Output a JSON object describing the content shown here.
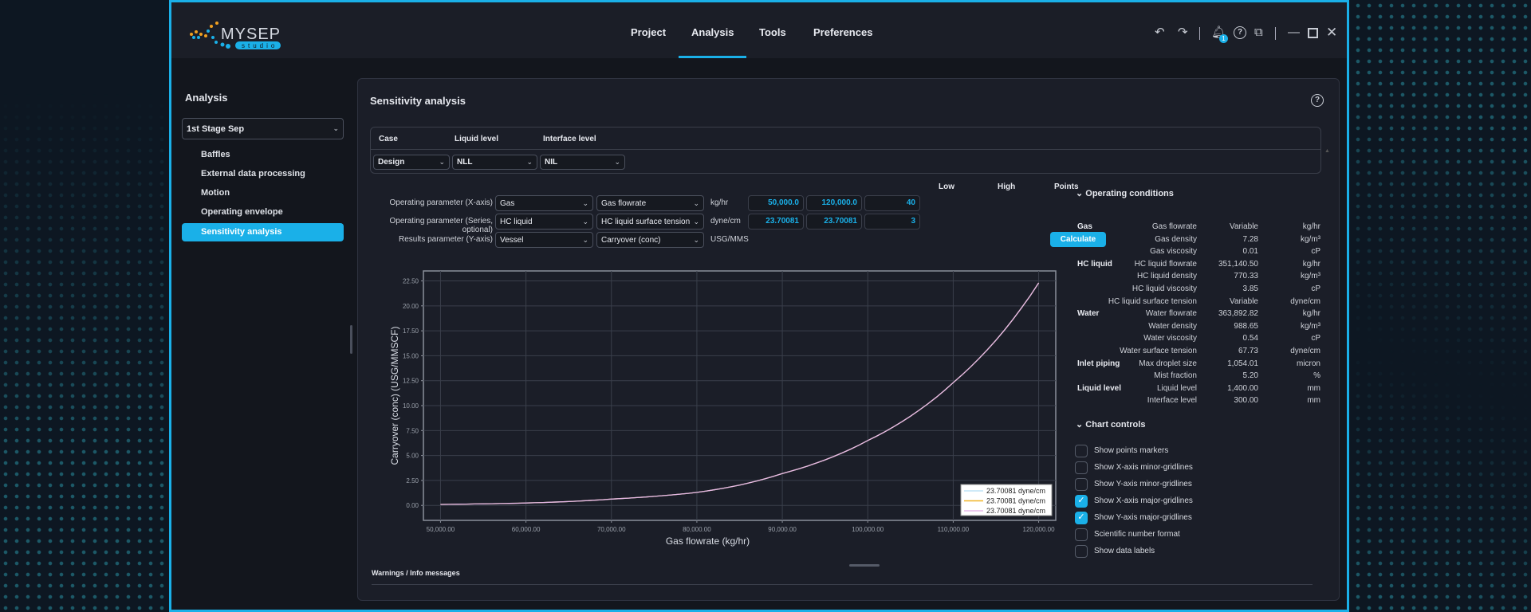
{
  "app": {
    "logo_text": "MYSEP",
    "logo_sub": "studio"
  },
  "nav": {
    "items": [
      "Project",
      "Analysis",
      "Tools",
      "Preferences"
    ],
    "active": "Analysis"
  },
  "toolbar": {
    "notifications_count": "1",
    "icons": [
      "undo-icon",
      "redo-icon",
      "bell-icon",
      "help-icon",
      "copy-icon",
      "minimize-icon",
      "maximize-icon",
      "close-icon"
    ]
  },
  "sidebar": {
    "title": "Analysis",
    "vessel": "1st Stage Sep",
    "items": [
      "Baffles",
      "External data processing",
      "Motion",
      "Operating envelope",
      "Sensitivity analysis"
    ],
    "active": "Sensitivity analysis"
  },
  "main": {
    "title": "Sensitivity analysis",
    "case": {
      "headers": [
        "Case",
        "Liquid level",
        "Interface level"
      ],
      "values": [
        "Design",
        "NLL",
        "NIL"
      ]
    },
    "params": {
      "headers": {
        "low": "Low",
        "high": "High",
        "points": "Points"
      },
      "rows": [
        {
          "label": "Operating parameter (X-axis)",
          "group": "Gas",
          "param": "Gas flowrate",
          "unit": "kg/hr",
          "low": "50,000.0",
          "high": "120,000.0",
          "points": "40"
        },
        {
          "label": "Operating parameter (Series, optional)",
          "group": "HC liquid",
          "param": "HC liquid surface tension",
          "unit": "dyne/cm",
          "low": "23.70081",
          "high": "23.70081",
          "points": "3"
        },
        {
          "label": "Results parameter (Y-axis)",
          "group": "Vessel",
          "param": "Carryover (conc)",
          "unit": "USG/MMS"
        }
      ],
      "calculate_label": "Calculate"
    },
    "warnings_label": "Warnings / Info messages"
  },
  "operating_conditions": {
    "title": "Operating conditions",
    "rows": [
      {
        "group": "Gas",
        "name": "Gas flowrate",
        "value": "Variable",
        "unit": "kg/hr"
      },
      {
        "group": "",
        "name": "Gas density",
        "value": "7.28",
        "unit": "kg/m³"
      },
      {
        "group": "",
        "name": "Gas viscosity",
        "value": "0.01",
        "unit": "cP"
      },
      {
        "group": "HC liquid",
        "name": "HC liquid flowrate",
        "value": "351,140.50",
        "unit": "kg/hr"
      },
      {
        "group": "",
        "name": "HC liquid density",
        "value": "770.33",
        "unit": "kg/m³"
      },
      {
        "group": "",
        "name": "HC liquid viscosity",
        "value": "3.85",
        "unit": "cP"
      },
      {
        "group": "",
        "name": "HC liquid surface tension",
        "value": "Variable",
        "unit": "dyne/cm"
      },
      {
        "group": "Water",
        "name": "Water flowrate",
        "value": "363,892.82",
        "unit": "kg/hr"
      },
      {
        "group": "",
        "name": "Water density",
        "value": "988.65",
        "unit": "kg/m³"
      },
      {
        "group": "",
        "name": "Water viscosity",
        "value": "0.54",
        "unit": "cP"
      },
      {
        "group": "",
        "name": "Water surface tension",
        "value": "67.73",
        "unit": "dyne/cm"
      },
      {
        "group": "Inlet piping",
        "name": "Max droplet size",
        "value": "1,054.01",
        "unit": "micron"
      },
      {
        "group": "",
        "name": "Mist fraction",
        "value": "5.20",
        "unit": "%"
      },
      {
        "group": "Liquid level",
        "name": "Liquid level",
        "value": "1,400.00",
        "unit": "mm"
      },
      {
        "group": "",
        "name": "Interface level",
        "value": "300.00",
        "unit": "mm"
      }
    ]
  },
  "chart_controls": {
    "title": "Chart controls",
    "items": [
      {
        "label": "Show points markers",
        "checked": false
      },
      {
        "label": "Show X-axis minor-gridlines",
        "checked": false
      },
      {
        "label": "Show Y-axis minor-gridlines",
        "checked": false
      },
      {
        "label": "Show X-axis major-gridlines",
        "checked": true
      },
      {
        "label": "Show Y-axis major-gridlines",
        "checked": true
      },
      {
        "label": "Scientific number format",
        "checked": false
      },
      {
        "label": "Show data labels",
        "checked": false
      }
    ]
  },
  "chart_data": {
    "type": "line",
    "xlabel": "Gas flowrate (kg/hr)",
    "ylabel": "Carryover (conc) (USG/MMSCF)",
    "xlim": [
      48000,
      122000
    ],
    "ylim": [
      -1.5,
      23.5
    ],
    "xticks": [
      "50,000.00",
      "60,000.00",
      "70,000.00",
      "80,000.00",
      "90,000.00",
      "100,000.00",
      "110,000.00",
      "120,000.00"
    ],
    "yticks": [
      "0.00",
      "2.50",
      "5.00",
      "7.50",
      "10.00",
      "12.50",
      "15.00",
      "17.50",
      "20.00",
      "22.50"
    ],
    "grid": true,
    "legend_position": "bottom-right",
    "x": [
      50000,
      60000,
      70000,
      80000,
      90000,
      100000,
      110000,
      120000
    ],
    "series": [
      {
        "name": "23.70081 dyne/cm",
        "color": "#bfe3f5",
        "values": [
          0.1,
          0.24,
          0.63,
          1.3,
          3.2,
          6.5,
          12.3,
          22.3
        ]
      },
      {
        "name": "23.70081 dyne/cm",
        "color": "#f0b429",
        "values": [
          0.1,
          0.24,
          0.63,
          1.3,
          3.2,
          6.5,
          12.3,
          22.3
        ]
      },
      {
        "name": "23.70081 dyne/cm",
        "color": "#e6b8e8",
        "values": [
          0.1,
          0.24,
          0.63,
          1.3,
          3.2,
          6.5,
          12.3,
          22.3
        ]
      }
    ]
  },
  "colors": {
    "accent": "#1ab0e8",
    "panel": "#1b1e28",
    "background": "#13161d"
  }
}
